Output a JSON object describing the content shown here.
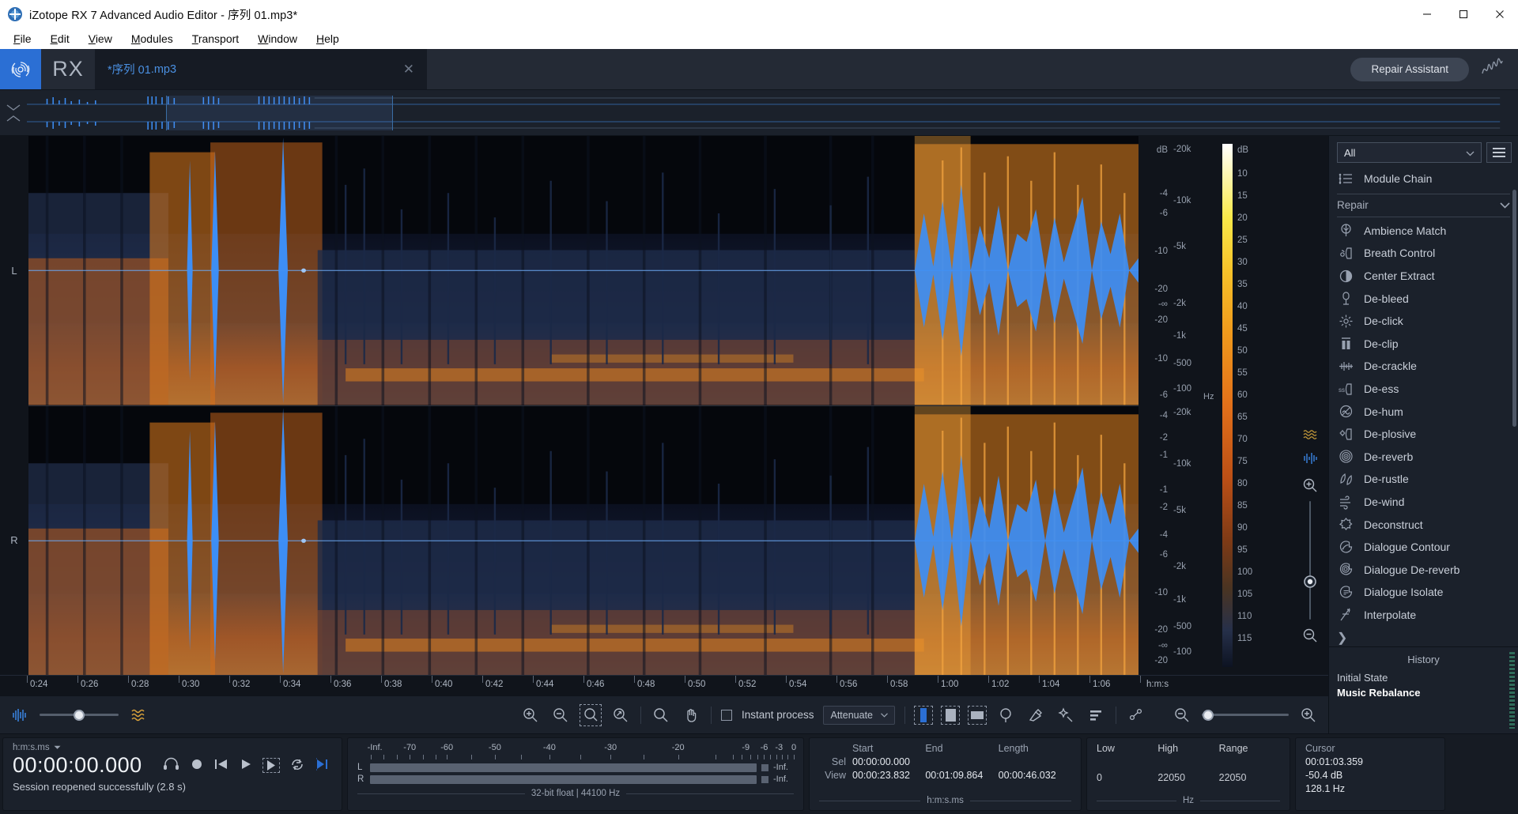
{
  "window": {
    "title": "iZotope RX 7 Advanced Audio Editor - 序列 01.mp3*",
    "minimize": "—",
    "maximize": "▢",
    "close": "✕"
  },
  "menubar": [
    "File",
    "Edit",
    "View",
    "Modules",
    "Transport",
    "Window",
    "Help"
  ],
  "topbar": {
    "logo": "RX",
    "tab_name": "*序列 01",
    "tab_ext": ".mp3",
    "tab_close": "✕",
    "repair_assistant": "Repair Assistant"
  },
  "channels": [
    "L",
    "R"
  ],
  "axis": {
    "db_unit": "dB",
    "hz_unit": "Hz",
    "db_labels": [
      "-4",
      "-6",
      "-10",
      "-20",
      "-∞",
      "-20",
      "-10",
      "-6",
      "-4",
      "-2",
      "-1"
    ],
    "hz_labels": [
      "20k",
      "10k",
      "5k",
      "2k",
      "1k",
      "500",
      "100"
    ],
    "colorbar_unit": "dB",
    "colorbar_labels": [
      "10",
      "15",
      "20",
      "25",
      "30",
      "35",
      "40",
      "45",
      "50",
      "55",
      "60",
      "65",
      "70",
      "75",
      "80",
      "85",
      "90",
      "95",
      "100",
      "105",
      "110",
      "115"
    ]
  },
  "ruler": {
    "unit": "h:m:s",
    "ticks": [
      "0:24",
      "0:26",
      "0:28",
      "0:30",
      "0:32",
      "0:34",
      "0:36",
      "0:38",
      "0:40",
      "0:42",
      "0:44",
      "0:46",
      "0:48",
      "0:50",
      "0:52",
      "0:54",
      "0:56",
      "0:58",
      "1:00",
      "1:02",
      "1:04",
      "1:06"
    ]
  },
  "toolbar": {
    "instant_process_label": "Instant process",
    "instant_process_checked": false,
    "process_mode": "Attenuate",
    "tools": [
      "zoom-in",
      "zoom-out",
      "zoom-to-selection",
      "zoom-fit",
      "magnifier",
      "hand",
      "time-selection",
      "rect-selection",
      "freq-selection",
      "lasso-selection",
      "brush-selection",
      "magic-wand",
      "level-selection",
      "pen"
    ],
    "waveform_icon": "waveform-icon",
    "spectrogram_icon": "spectrogram-icon",
    "blend_value": 50
  },
  "status": {
    "time_format": "h:m:s.ms",
    "playhead": "00:00:00.000",
    "message": "Session reopened successfully (2.8 s)",
    "transport": [
      "monitor",
      "record",
      "rewind",
      "play",
      "play-selection",
      "loop",
      "play-to-end"
    ]
  },
  "meter": {
    "scale": [
      "-Inf.",
      "-70",
      "-60",
      "-50",
      "-40",
      "-30",
      "-20",
      "-9",
      "-6",
      "-3",
      "0"
    ],
    "channels": [
      "L",
      "R"
    ],
    "peak_l": "-Inf.",
    "peak_r": "-Inf.",
    "format": "32-bit float | 44100 Hz"
  },
  "selection": {
    "headers": [
      "Start",
      "End",
      "Length"
    ],
    "rows": [
      {
        "label": "Sel",
        "start": "00:00:00.000",
        "end": "",
        "length": ""
      },
      {
        "label": "View",
        "start": "00:00:23.832",
        "end": "00:01:09.864",
        "length": "00:00:46.032"
      }
    ],
    "unit": "h:m:s.ms"
  },
  "frequency": {
    "headers": [
      "Low",
      "High",
      "Range"
    ],
    "values": [
      "0",
      "22050",
      "22050"
    ],
    "unit": "Hz"
  },
  "cursor": {
    "header": "Cursor",
    "time": "00:01:03.359",
    "level": "-50.4 dB",
    "freq": "128.1 Hz"
  },
  "sidebar": {
    "filter": "All",
    "menu_icon": "hamburger-icon",
    "module_chain": "Module Chain",
    "group": "Repair",
    "modules": [
      {
        "label": "Ambience Match",
        "icon": "ambience-match-icon"
      },
      {
        "label": "Breath Control",
        "icon": "breath-control-icon"
      },
      {
        "label": "Center Extract",
        "icon": "center-extract-icon"
      },
      {
        "label": "De-bleed",
        "icon": "de-bleed-icon"
      },
      {
        "label": "De-click",
        "icon": "de-click-icon"
      },
      {
        "label": "De-clip",
        "icon": "de-clip-icon"
      },
      {
        "label": "De-crackle",
        "icon": "de-crackle-icon"
      },
      {
        "label": "De-ess",
        "icon": "de-ess-icon"
      },
      {
        "label": "De-hum",
        "icon": "de-hum-icon"
      },
      {
        "label": "De-plosive",
        "icon": "de-plosive-icon"
      },
      {
        "label": "De-reverb",
        "icon": "de-reverb-icon"
      },
      {
        "label": "De-rustle",
        "icon": "de-rustle-icon"
      },
      {
        "label": "De-wind",
        "icon": "de-wind-icon"
      },
      {
        "label": "Deconstruct",
        "icon": "deconstruct-icon"
      },
      {
        "label": "Dialogue Contour",
        "icon": "dialogue-contour-icon"
      },
      {
        "label": "Dialogue De-reverb",
        "icon": "dialogue-dereverb-icon"
      },
      {
        "label": "Dialogue Isolate",
        "icon": "dialogue-isolate-icon"
      },
      {
        "label": "Interpolate",
        "icon": "interpolate-icon"
      }
    ],
    "more": "❯"
  },
  "history": {
    "title": "History",
    "items": [
      {
        "label": "Initial State",
        "current": false
      },
      {
        "label": "Music Rebalance",
        "current": true
      }
    ]
  },
  "colors": {
    "accent": "#2b6fd4",
    "tab_text": "#4a90e2",
    "waveform": "#3d8ef5",
    "spectro_hot": "#f09a1c",
    "panel_bg": "#1b212b"
  }
}
